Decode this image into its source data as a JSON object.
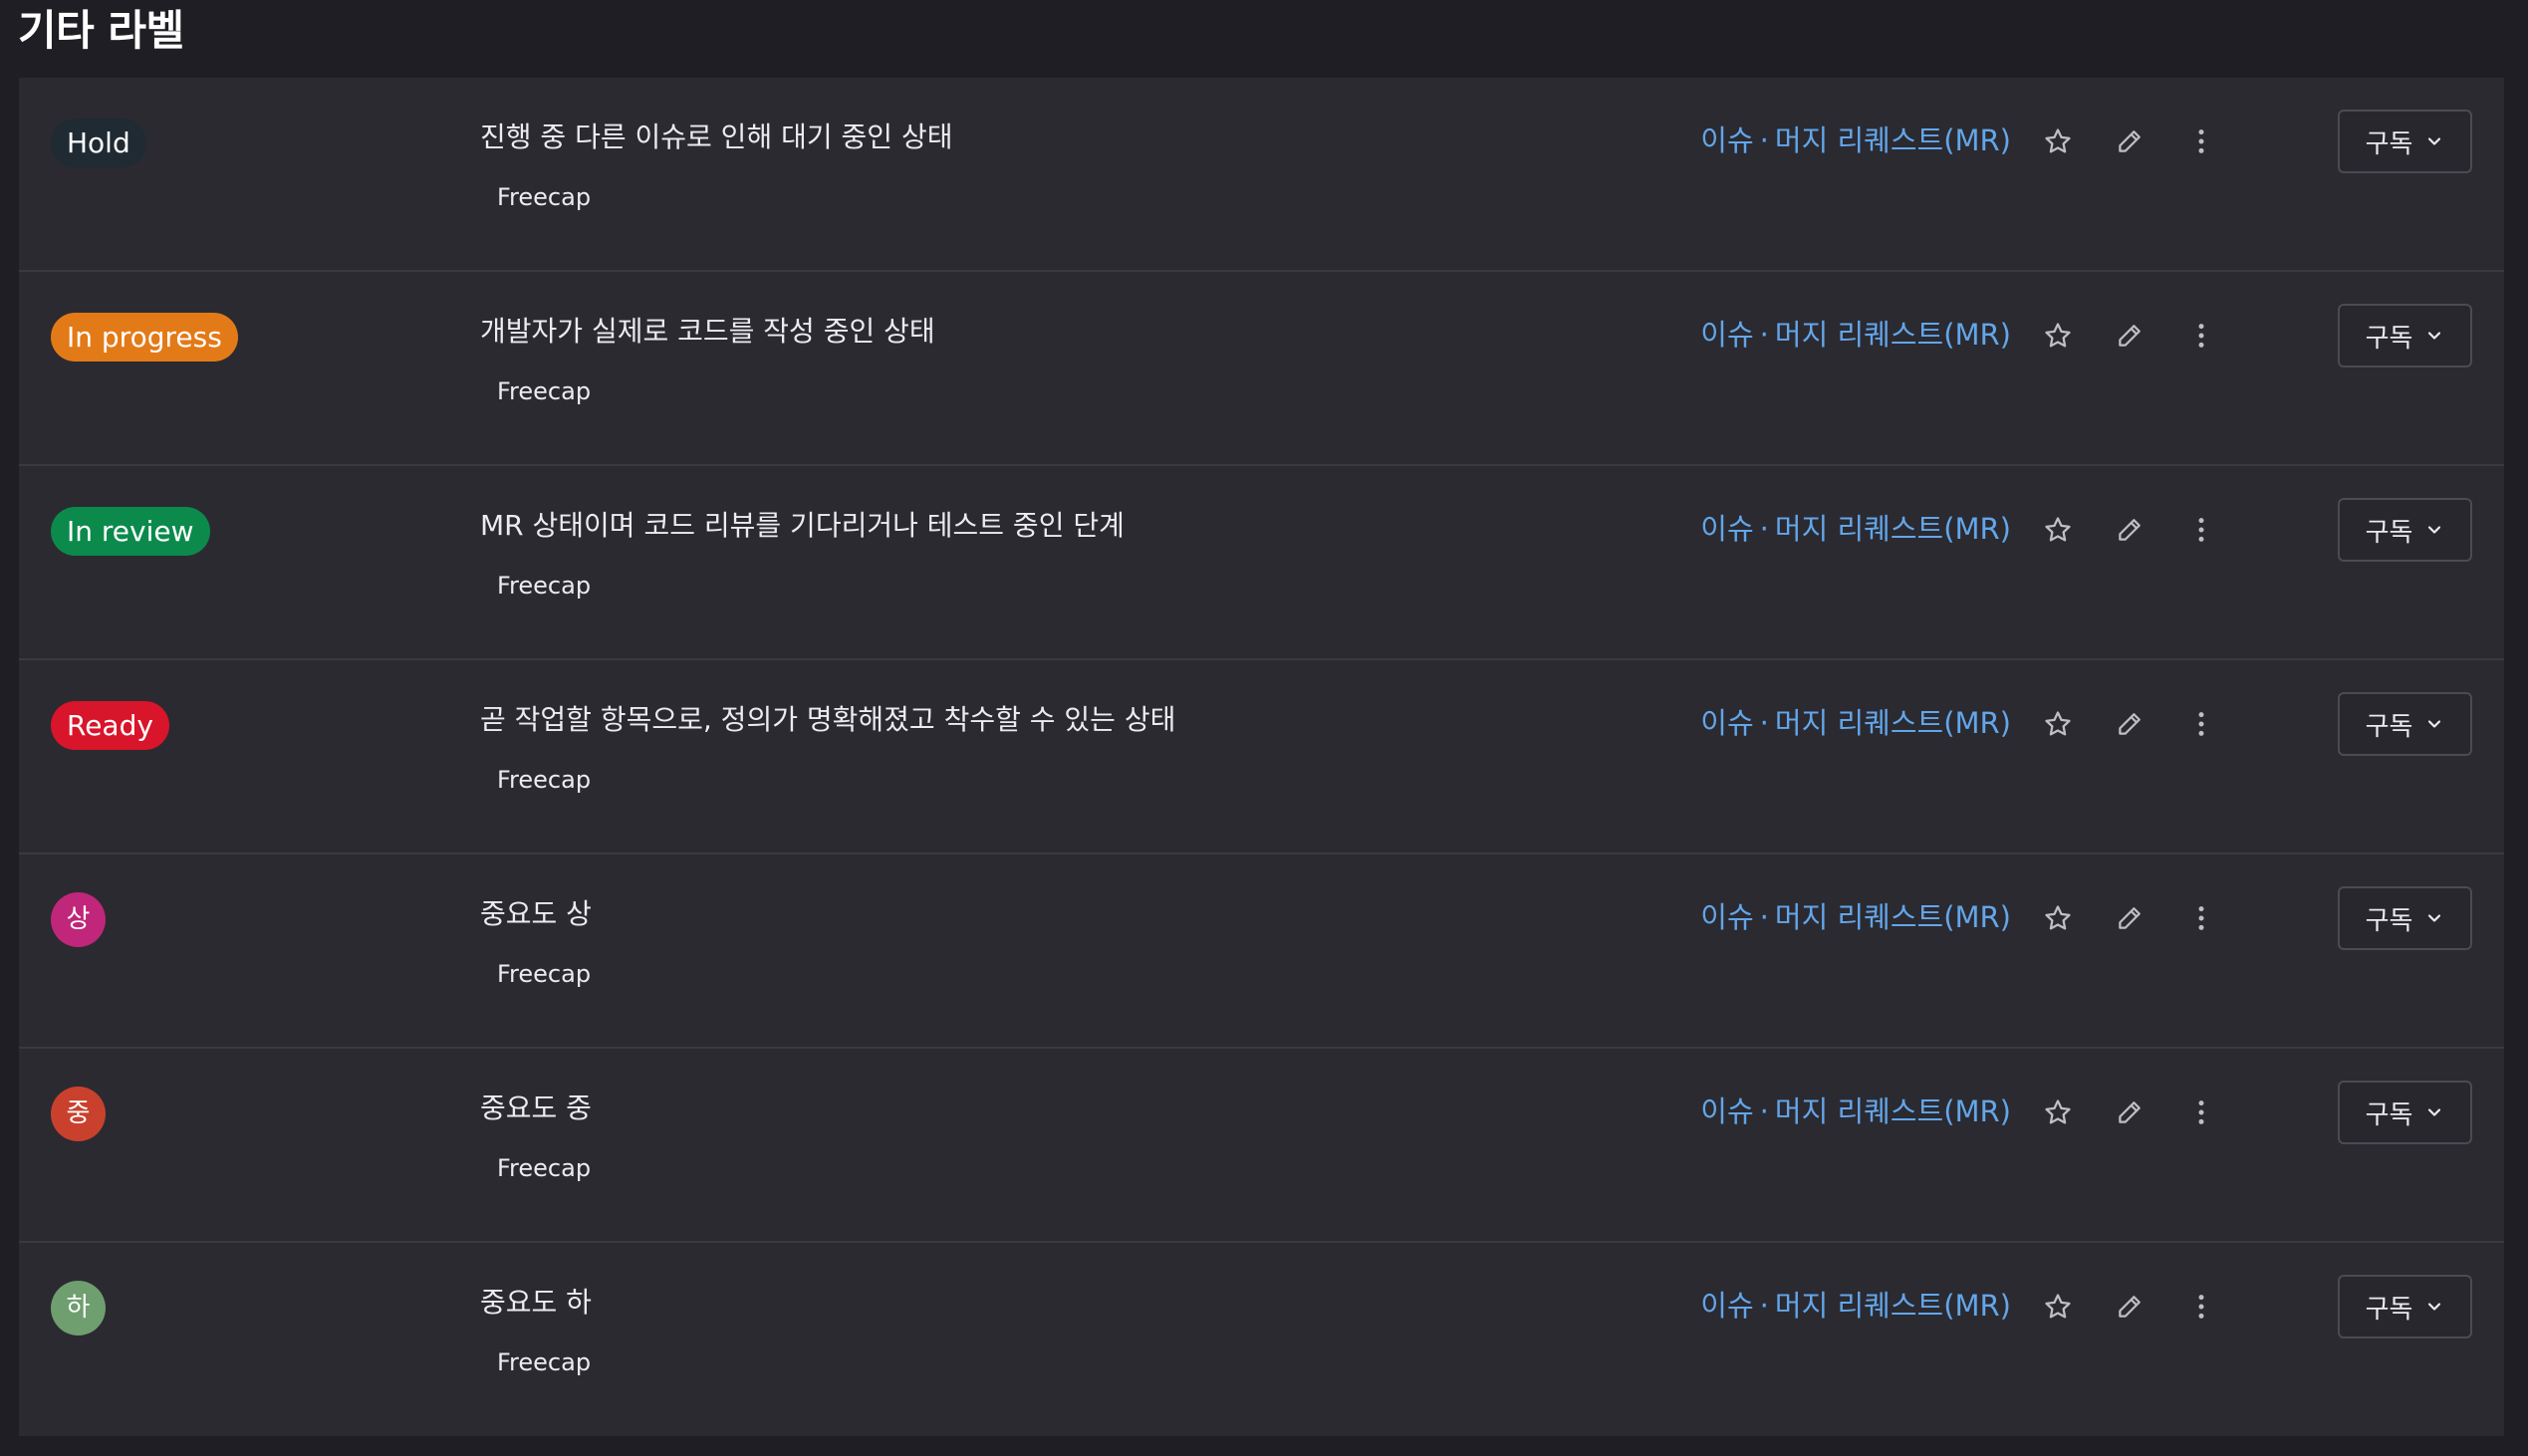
{
  "section_title": "기타 라벨",
  "labels": [
    {
      "name": "Hold",
      "color": "#1f2a33",
      "shape": "pill",
      "description": "진행 중 다른 이슈로 인해 대기 중인 상태",
      "project": "Freecap"
    },
    {
      "name": "In progress",
      "color": "#e37a18",
      "shape": "pill",
      "description": "개발자가 실제로 코드를 작성 중인 상태",
      "project": "Freecap"
    },
    {
      "name": "In review",
      "color": "#0b8a4c",
      "shape": "pill",
      "description": "MR 상태이며 코드 리뷰를 기다리거나 테스트 중인 단계",
      "project": "Freecap"
    },
    {
      "name": "Ready",
      "color": "#d8152a",
      "shape": "pill",
      "description": "곧 작업할 항목으로, 정의가 명확해졌고 착수할 수 있는 상태",
      "project": "Freecap"
    },
    {
      "name": "상",
      "color": "#c0267a",
      "shape": "round",
      "description": "중요도 상",
      "project": "Freecap"
    },
    {
      "name": "중",
      "color": "#c9412d",
      "shape": "round",
      "description": "중요도 중",
      "project": "Freecap"
    },
    {
      "name": "하",
      "color": "#6f9e6f",
      "shape": "round",
      "description": "중요도 하",
      "project": "Freecap"
    }
  ],
  "row_actions": {
    "issues_link": "이슈",
    "separator": "·",
    "mr_link": "머지 리퀘스트(MR)",
    "star_icon": "star-icon",
    "edit_icon": "pencil-icon",
    "more_icon": "kebab-menu-icon",
    "subscribe_label": "구독",
    "subscribe_icon": "chevron-down-icon"
  }
}
